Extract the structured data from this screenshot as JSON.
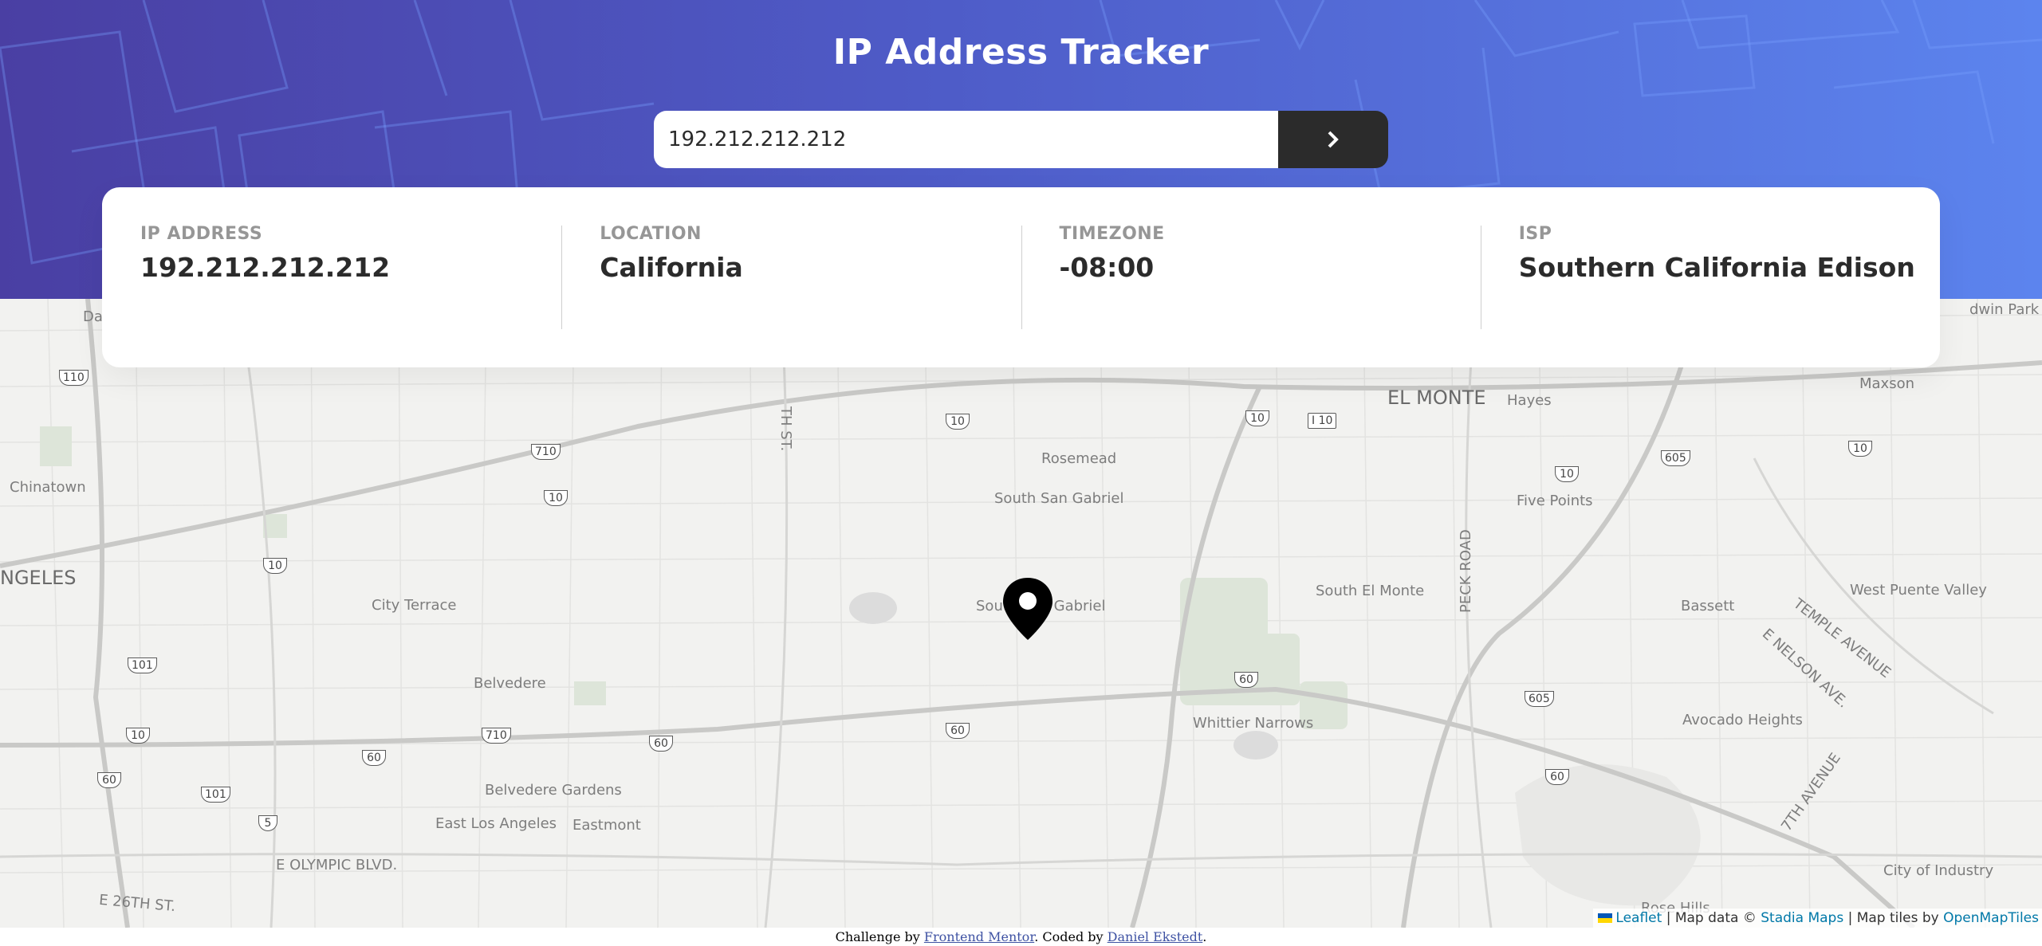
{
  "header": {
    "title": "IP Address Tracker",
    "gradient": [
      "#4a3fa3",
      "#5c84ee"
    ]
  },
  "search": {
    "value": "192.212.212.212",
    "submit_icon": "chevron-right-icon"
  },
  "info": [
    {
      "label": "IP ADDRESS",
      "value": "192.212.212.212"
    },
    {
      "label": "LOCATION",
      "value": "California"
    },
    {
      "label": "TIMEZONE",
      "value": "-08:00"
    },
    {
      "label": "ISP",
      "value": "Southern California Edison"
    }
  ],
  "map": {
    "labels": {
      "el_monte": "EL MONTE",
      "hayes": "Hayes",
      "maxson": "Maxson",
      "baldwin_park": "dwin Park",
      "rosemead": "Rosemead",
      "south_san_gabriel": "South San Gabriel",
      "san_gabriel": "South San Gabriel",
      "five_points": "Five Points",
      "chinatown": "Chinatown",
      "los_angeles": "NGELES",
      "city_terrace": "City Terrace",
      "south_el_monte": "South El Monte",
      "peck_road": "PECK ROAD",
      "bassett": "Bassett",
      "west_puente_valley": "West Puente Valley",
      "temple_avenue": "TEMPLE AVENUE",
      "nelson_ave": "E NELSON AVE.",
      "avocado_heights": "Avocado Heights",
      "whittier_narrows": "Whittier Narrows",
      "belvedere": "Belvedere",
      "belvedere_gardens": "Belvedere Gardens",
      "east_los_angeles": "East Los Angeles",
      "eastmont": "Eastmont",
      "e_olympic": "E OLYMPIC BLVD.",
      "e_26th": "E 26TH ST.",
      "seventh_avenue": "7TH AVENUE",
      "city_of_industry": "City of Industry",
      "rose_hills": "Rose Hills",
      "th_st": "TH ST.",
      "da": "Da"
    },
    "shields": {
      "i110": "110",
      "i10": "10",
      "i710": "710",
      "i101": "101",
      "i60": "60",
      "i5": "5",
      "i605": "605",
      "i10b": "I 10"
    },
    "marker_icon": "location-pin-icon",
    "attribution": {
      "leaflet": "Leaflet",
      "sep1": " | Map data © ",
      "stadia": "Stadia Maps",
      "sep2": " | Map tiles by ",
      "omt": "OpenMapTiles"
    }
  },
  "footer": {
    "prefix": "Challenge by ",
    "fm": "Frontend Mentor",
    "mid": ". Coded by ",
    "author": "Daniel Ekstedt",
    "suffix": "."
  }
}
